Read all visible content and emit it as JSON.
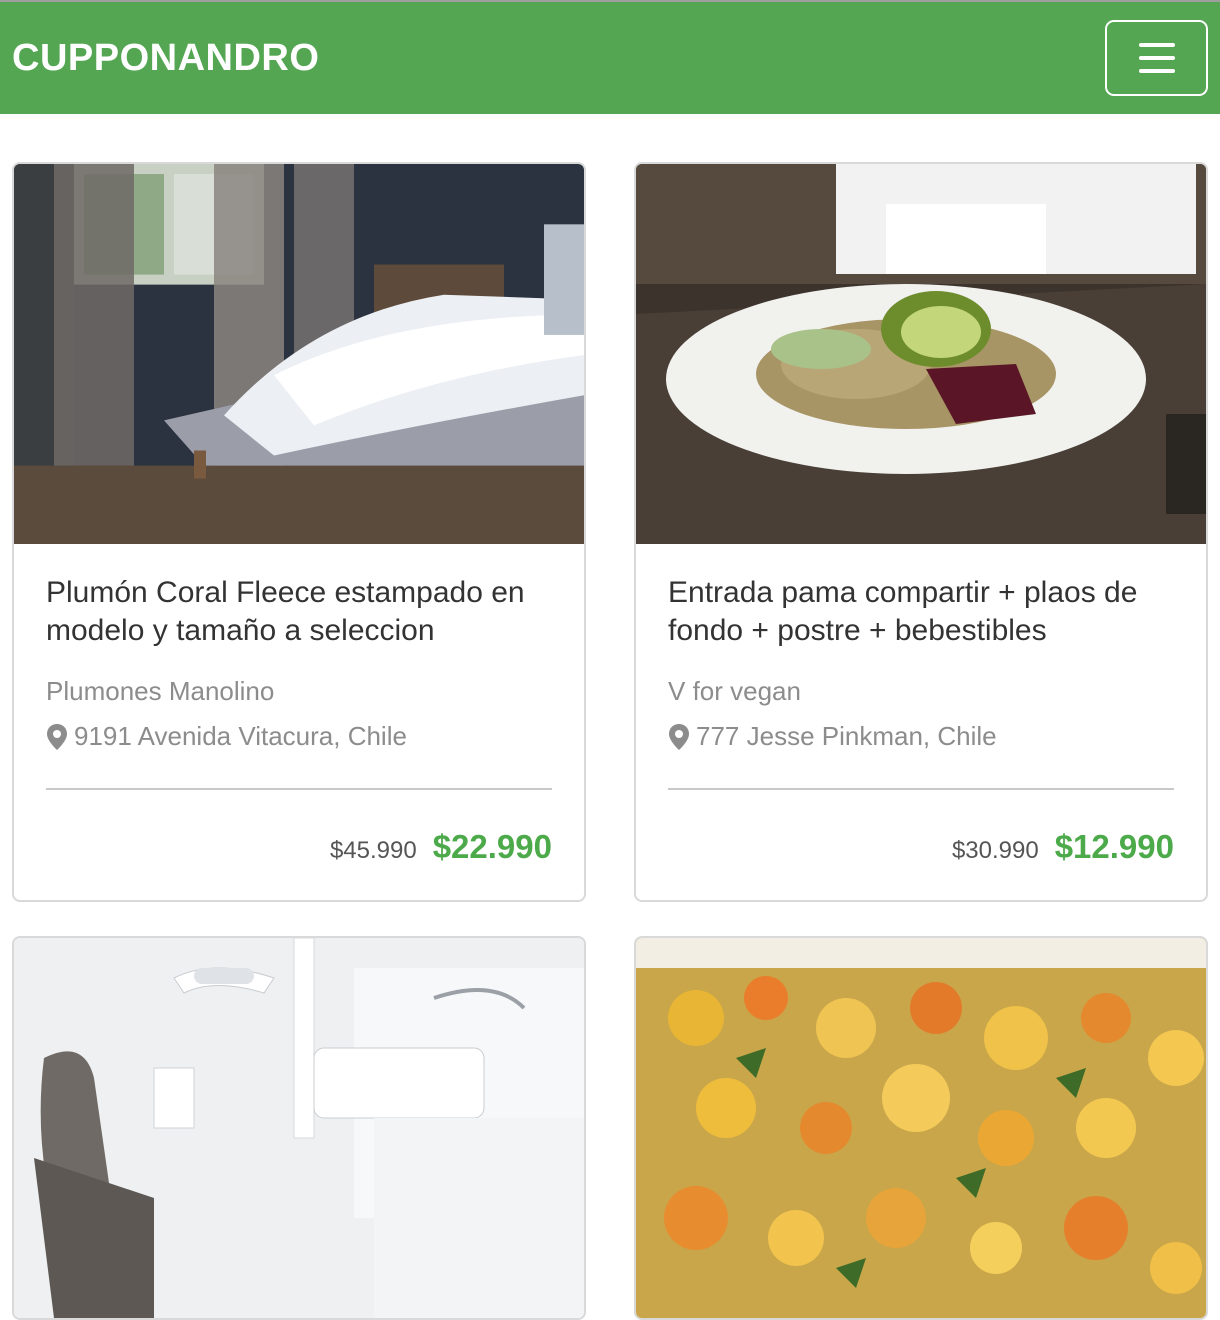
{
  "header": {
    "brand": "CUPPONANDRO",
    "menu_icon": "hamburger-icon",
    "background": "#54a653"
  },
  "deals": [
    {
      "image": "bedroom-photo",
      "title": "Plumón Coral Fleece estampado en modelo y tamaño a seleccion",
      "merchant": "Plumones Manolino",
      "location": "9191 Avenida Vitacura, Chile",
      "old_price": "$45.990",
      "new_price": "$22.990"
    },
    {
      "image": "salad-bowl-photo",
      "title": "Entrada pama compartir + plaos de fondo + postre + bebestibles",
      "merchant": "V for vegan",
      "location": "777 Jesse Pinkman, Chile",
      "old_price": "$30.990",
      "new_price": "$12.990"
    },
    {
      "image": "dental-clinic-photo"
    },
    {
      "image": "stew-photo"
    }
  ],
  "colors": {
    "accent": "#54a653",
    "price_green": "#4caa4a",
    "muted_text": "#8c8c8c"
  }
}
